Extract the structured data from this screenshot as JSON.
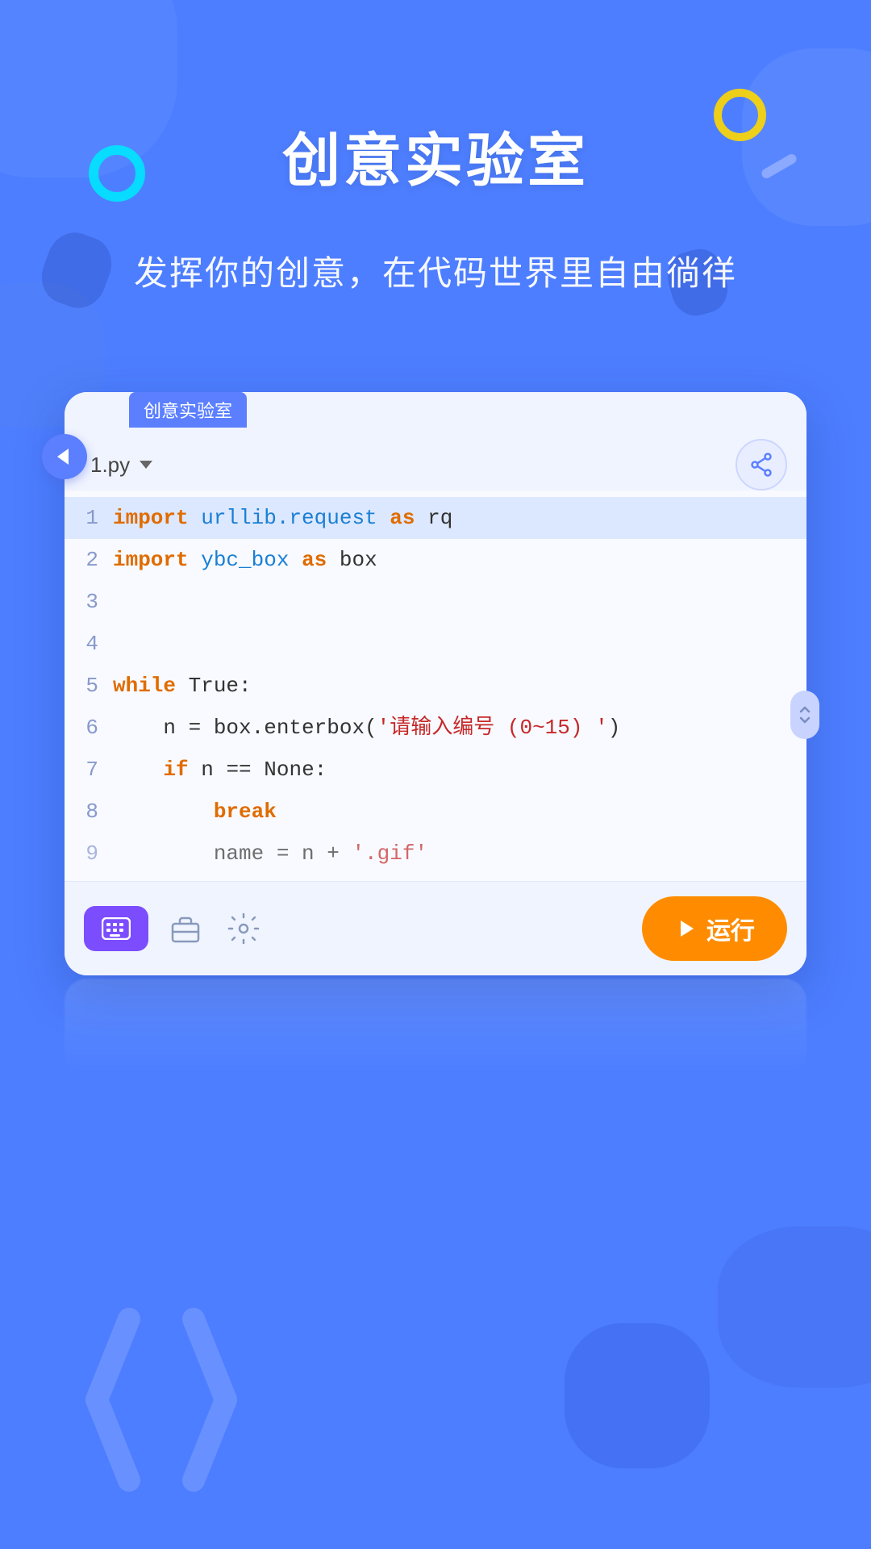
{
  "page": {
    "title": "创意实验室",
    "subtitle": "发挥你的创意，在代码世界里自由徜徉"
  },
  "editor": {
    "tab_label": "创意实验室",
    "file_name": "1.py",
    "share_label": "分享",
    "run_label": "运行",
    "back_label": "返回",
    "keyboard_label": "键盘",
    "lines": [
      {
        "num": "1",
        "highlighted": true,
        "segments": [
          {
            "text": "import",
            "cls": "kw"
          },
          {
            "text": " urllib.request ",
            "cls": "fn"
          },
          {
            "text": "as",
            "cls": "kw"
          },
          {
            "text": " rq",
            "cls": "plain"
          }
        ]
      },
      {
        "num": "2",
        "highlighted": false,
        "segments": [
          {
            "text": "import",
            "cls": "kw"
          },
          {
            "text": " ybc_box ",
            "cls": "fn"
          },
          {
            "text": "as",
            "cls": "kw"
          },
          {
            "text": " box",
            "cls": "plain"
          }
        ]
      },
      {
        "num": "3",
        "highlighted": false,
        "segments": []
      },
      {
        "num": "4",
        "highlighted": false,
        "segments": []
      },
      {
        "num": "5",
        "highlighted": false,
        "segments": [
          {
            "text": "while",
            "cls": "kw"
          },
          {
            "text": " True:",
            "cls": "plain"
          }
        ]
      },
      {
        "num": "6",
        "highlighted": false,
        "segments": [
          {
            "text": "    n = box.enterbox(",
            "cls": "plain"
          },
          {
            "text": "'请输入编号 (0~15) '",
            "cls": "str"
          },
          {
            "text": ")",
            "cls": "plain"
          }
        ]
      },
      {
        "num": "7",
        "highlighted": false,
        "segments": [
          {
            "text": "    ",
            "cls": "plain"
          },
          {
            "text": "if",
            "cls": "kw"
          },
          {
            "text": " n == None:",
            "cls": "plain"
          }
        ]
      },
      {
        "num": "8",
        "highlighted": false,
        "segments": [
          {
            "text": "        ",
            "cls": "plain"
          },
          {
            "text": "break",
            "cls": "kw"
          }
        ]
      },
      {
        "num": "9",
        "highlighted": false,
        "segments": [
          {
            "text": "        name = n + '.gif'",
            "cls": "plain"
          }
        ]
      }
    ]
  },
  "colors": {
    "bg_blue": "#4d7eff",
    "accent_cyan": "#00e5ff",
    "accent_yellow": "#ffd700",
    "run_orange": "#ff8c00",
    "keyboard_purple": "#7c4dff",
    "tab_blue": "#5b7fff"
  }
}
